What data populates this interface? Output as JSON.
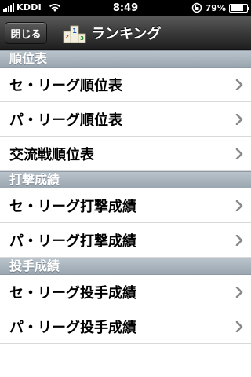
{
  "status_bar": {
    "carrier": "KDDI",
    "time": "8:49",
    "battery_text": "79%",
    "battery_level": 0.79,
    "signal_bars": 5,
    "icons": [
      "signal-icon",
      "wifi-icon",
      "rotation-lock-icon",
      "battery-icon"
    ]
  },
  "nav": {
    "close_label": "閉じる",
    "title": "ランキング",
    "icon": "podium-icon"
  },
  "sections": [
    {
      "header": "順位表",
      "items": [
        "セ・リーグ順位表",
        "パ・リーグ順位表",
        "交流戦順位表"
      ]
    },
    {
      "header": "打撃成績",
      "items": [
        "セ・リーグ打撃成績",
        "パ・リーグ打撃成績"
      ]
    },
    {
      "header": "投手成績",
      "items": [
        "セ・リーグ投手成績",
        "パ・リーグ投手成績"
      ]
    }
  ],
  "colors": {
    "nav_bar": "#2e2e2e",
    "section_header": "#a8b3bd",
    "chevron": "#8a8a8a"
  }
}
